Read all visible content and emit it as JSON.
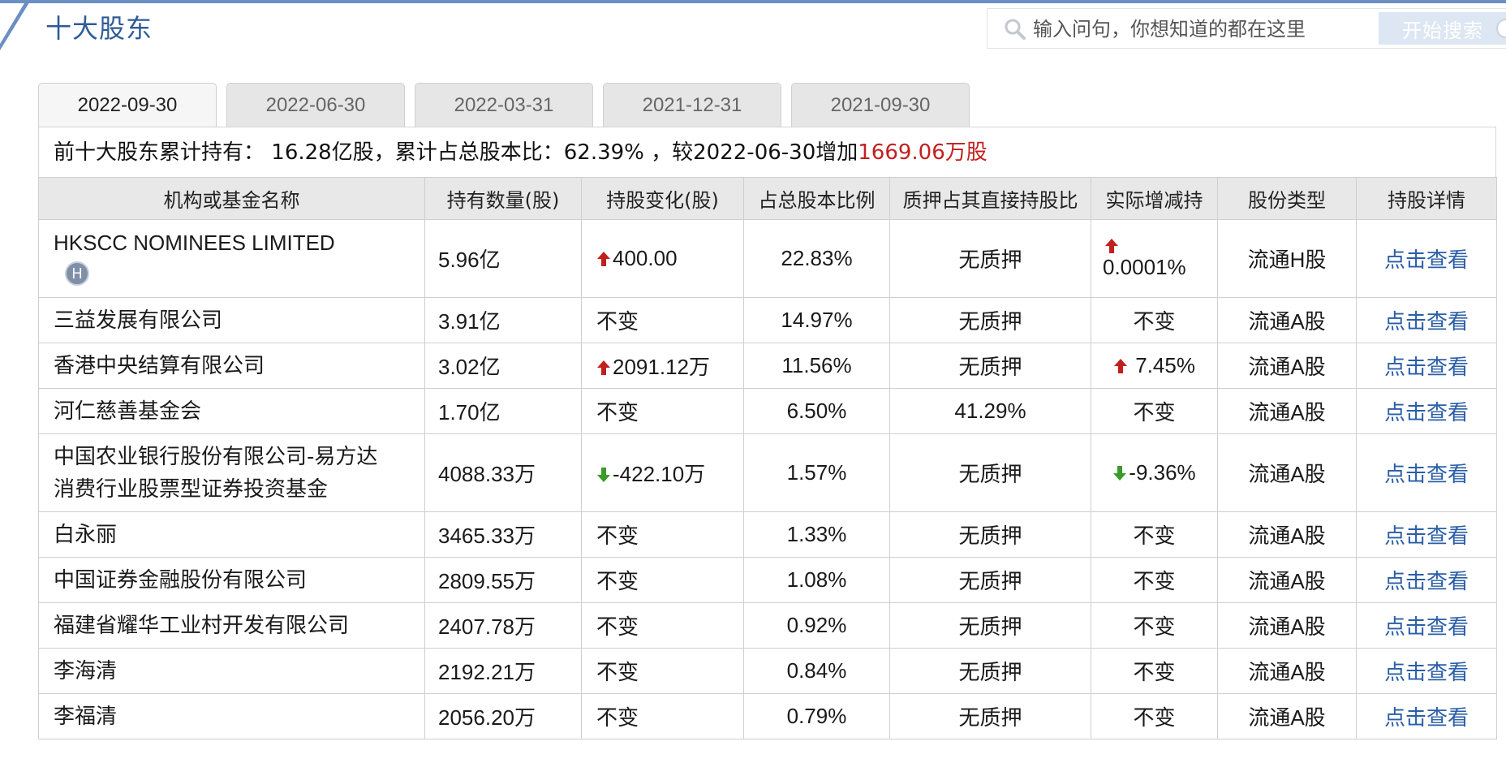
{
  "header": {
    "title": "十大股东",
    "search_placeholder": "输入问句，你想知道的都在这里",
    "search_button": "开始搜索"
  },
  "tabs": [
    {
      "label": "2022-09-30",
      "active": true
    },
    {
      "label": "2022-06-30",
      "active": false
    },
    {
      "label": "2022-03-31",
      "active": false
    },
    {
      "label": "2021-12-31",
      "active": false
    },
    {
      "label": "2021-09-30",
      "active": false
    }
  ],
  "summary": {
    "prefix": "前十大股东累计持有：",
    "total_shares": " 16.28亿股，",
    "ratio_label": "累计占总股本比：",
    "ratio_value": "62.39%",
    "compare_text": " ，较2022-06-30增加",
    "change_value": "1669.06万股"
  },
  "table": {
    "columns": [
      "机构或基金名称",
      "持有数量(股)",
      "持股变化(股)",
      "占总股本比例",
      "质押占其直接持股比",
      "实际增减持",
      "股份类型",
      "持股详情"
    ],
    "rows": [
      {
        "name": "HKSCC NOMINEES LIMITED",
        "badge": "H",
        "shares": "5.96亿",
        "change": "400.00",
        "change_dir": "up",
        "ratio": "22.83%",
        "pledge": "无质押",
        "actual": "0.0001%",
        "actual_dir": "up",
        "type": "流通H股",
        "detail": "点击查看"
      },
      {
        "name": "三益发展有限公司",
        "shares": "3.91亿",
        "change": "不变",
        "change_dir": "none",
        "ratio": "14.97%",
        "pledge": "无质押",
        "actual": "不变",
        "actual_dir": "none",
        "type": "流通A股",
        "detail": "点击查看"
      },
      {
        "name": "香港中央结算有限公司",
        "shares": "3.02亿",
        "change": "2091.12万",
        "change_dir": "up",
        "ratio": "11.56%",
        "pledge": "无质押",
        "actual": "7.45%",
        "actual_dir": "up",
        "type": "流通A股",
        "detail": "点击查看"
      },
      {
        "name": "河仁慈善基金会",
        "shares": "1.70亿",
        "change": "不变",
        "change_dir": "none",
        "ratio": "6.50%",
        "pledge": "41.29%",
        "actual": "不变",
        "actual_dir": "none",
        "type": "流通A股",
        "detail": "点击查看"
      },
      {
        "name_line1": "中国农业银行股份有限公司-易方达",
        "name_line2": "消费行业股票型证券投资基金",
        "shares": "4088.33万",
        "change": "-422.10万",
        "change_dir": "down",
        "ratio": "1.57%",
        "pledge": "无质押",
        "actual": "-9.36%",
        "actual_dir": "down",
        "type": "流通A股",
        "detail": "点击查看"
      },
      {
        "name": "白永丽",
        "shares": "3465.33万",
        "change": "不变",
        "change_dir": "none",
        "ratio": "1.33%",
        "pledge": "无质押",
        "actual": "不变",
        "actual_dir": "none",
        "type": "流通A股",
        "detail": "点击查看"
      },
      {
        "name": "中国证券金融股份有限公司",
        "shares": "2809.55万",
        "change": "不变",
        "change_dir": "none",
        "ratio": "1.08%",
        "pledge": "无质押",
        "actual": "不变",
        "actual_dir": "none",
        "type": "流通A股",
        "detail": "点击查看"
      },
      {
        "name": "福建省耀华工业村开发有限公司",
        "shares": "2407.78万",
        "change": "不变",
        "change_dir": "none",
        "ratio": "0.92%",
        "pledge": "无质押",
        "actual": "不变",
        "actual_dir": "none",
        "type": "流通A股",
        "detail": "点击查看"
      },
      {
        "name": "李海清",
        "shares": "2192.21万",
        "change": "不变",
        "change_dir": "none",
        "ratio": "0.84%",
        "pledge": "无质押",
        "actual": "不变",
        "actual_dir": "none",
        "type": "流通A股",
        "detail": "点击查看"
      },
      {
        "name": "李福清",
        "shares": "2056.20万",
        "change": "不变",
        "change_dir": "none",
        "ratio": "0.79%",
        "pledge": "无质押",
        "actual": "不变",
        "actual_dir": "none",
        "type": "流通A股",
        "detail": "点击查看"
      }
    ]
  },
  "colors": {
    "accent": "#2f5b97",
    "up": "#c1201f",
    "down": "#3a9b28",
    "link": "#2a5ea7"
  }
}
